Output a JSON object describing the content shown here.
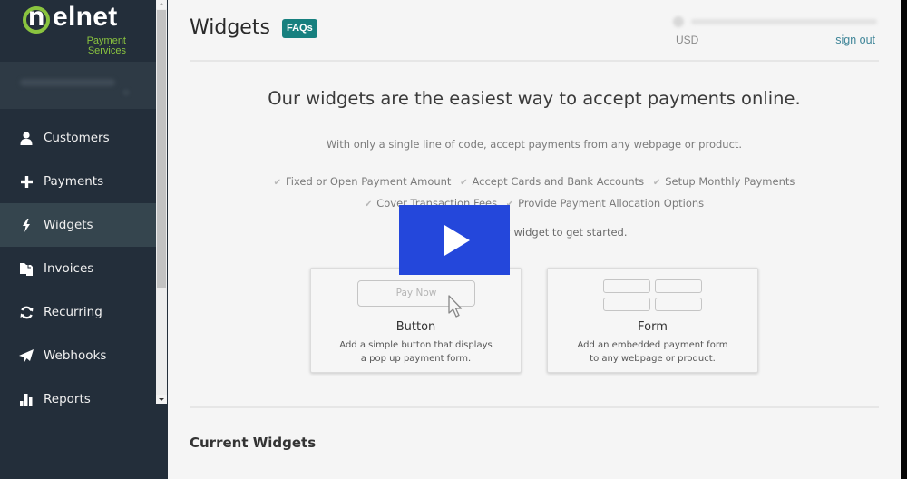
{
  "brand": {
    "logo_text": "nelnet",
    "logo_sub_line1": "Payment",
    "logo_sub_line2": "Services",
    "accent_green": "#8ac43f",
    "accent_teal": "#17807f",
    "sidebar_bg": "#232e3a"
  },
  "sidebar": {
    "items": [
      {
        "label": "Customers",
        "icon": "user-icon",
        "active": false
      },
      {
        "label": "Payments",
        "icon": "plus-icon",
        "active": false
      },
      {
        "label": "Widgets",
        "icon": "lightning-bolt-icon",
        "active": true
      },
      {
        "label": "Invoices",
        "icon": "documents-icon",
        "active": false
      },
      {
        "label": "Recurring",
        "icon": "refresh-icon",
        "active": false
      },
      {
        "label": "Webhooks",
        "icon": "paper-plane-icon",
        "active": false
      },
      {
        "label": "Reports",
        "icon": "bar-chart-icon",
        "active": false
      }
    ]
  },
  "header": {
    "title": "Widgets",
    "faqs_label": "FAQs",
    "currency": "USD",
    "signout_label": "sign out"
  },
  "hero": {
    "title": "Our widgets are the easiest way to accept payments online.",
    "subtitle": "With only a single line of code, accept payments from any webpage or product.",
    "features": [
      "Fixed or Open Payment Amount",
      "Accept Cards and Bank Accounts",
      "Setup Monthly Payments",
      "Cover Transaction Fees",
      "Provide Payment Allocation Options"
    ],
    "check_glyph": "✔",
    "cta": "Create a new widget to get started."
  },
  "widget_types": [
    {
      "title": "Button",
      "preview_label": "Pay Now",
      "desc_line1": "Add a simple button that displays",
      "desc_line2": "a pop up payment form."
    },
    {
      "title": "Form",
      "desc_line1": "Add an embedded payment form",
      "desc_line2": "to any webpage or product."
    }
  ],
  "current_widgets": {
    "title": "Current Widgets"
  },
  "video_overlay": {
    "icon": "play-icon",
    "color": "#2447db"
  }
}
